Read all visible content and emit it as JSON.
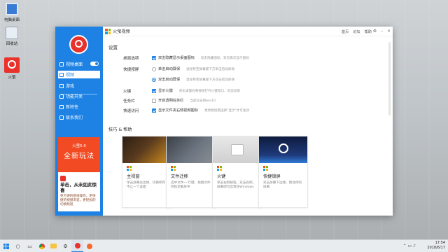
{
  "desktop": {
    "icons": [
      {
        "label": "电脑桌面"
      },
      {
        "label": "回收站"
      },
      {
        "label": "火萤"
      }
    ]
  },
  "window": {
    "title": "火萤视频",
    "links": [
      "首页",
      "论坛",
      "帮助"
    ]
  },
  "sidebar": {
    "items": [
      {
        "label": "视频桌面",
        "active": false
      },
      {
        "label": "视频",
        "active": true
      },
      {
        "label": "游戏",
        "active": false
      },
      {
        "label": "功能开关",
        "active": false
      },
      {
        "label": "新特性",
        "active": false
      },
      {
        "label": "联系我们",
        "active": false
      }
    ],
    "promo": {
      "version": "火萤5.0",
      "headline": "全新玩法",
      "title": "单击，从未如此惊喜",
      "desc": "更方便的壁纸操作，更快捷的视频浏览，更轻松的切换频道"
    }
  },
  "settings": {
    "heading": "设置",
    "rows": [
      {
        "label": "桌面选项",
        "options": [
          {
            "kind": "checkbox",
            "checked": true,
            "text": "双击隐藏显示桌面图标",
            "hint": "双击隐藏图标，双击再次显示图标"
          }
        ]
      },
      {
        "label": "快捷按屏",
        "options": [
          {
            "kind": "radio",
            "checked": false,
            "text": "单击启动屏保",
            "hint": "鼠标移至屏幕最下方单击启动屏保"
          },
          {
            "kind": "radio",
            "checked": true,
            "text": "双击启动屏保",
            "hint": "鼠标移至屏幕最下方双击启动屏保"
          }
        ]
      },
      {
        "label": "火键",
        "options": [
          {
            "kind": "checkbox",
            "checked": true,
            "text": "显示火键",
            "hint": "单击桌面右侧按钮打开火键窗口，双击退屏"
          }
        ]
      },
      {
        "label": "任务栏",
        "options": [
          {
            "kind": "checkbox",
            "checked": false,
            "text": "开启透明任务栏",
            "hint": "当前仅支持win10"
          }
        ]
      },
      {
        "label": "快速访问",
        "options": [
          {
            "kind": "checkbox",
            "checked": true,
            "text": "显示文件夹右侧视频图标",
            "hint": "更改壁纸需选择\"显示\"才可生效"
          }
        ]
      }
    ]
  },
  "tips": {
    "heading": "技巧 & 帮助",
    "cards": [
      {
        "title": "主视窗",
        "desc": "单击屏幕左边缘，切换所有不止一个桌面"
      },
      {
        "title": "文件迁移",
        "desc": "选中文件一 行键，拖拽文件到指定截屏中"
      },
      {
        "title": "火键",
        "desc": "单击右侧按钮，双击右侧，屏幕即可出现在Windows"
      },
      {
        "title": "快捷锁屏",
        "desc": "双击屏幕下边缘，锁住你的屏幕"
      }
    ]
  },
  "taskbar": {
    "time": "17:54",
    "date": "2018/6/17"
  },
  "colors": {
    "accent": "#1e82e4",
    "brand_red": "#e8322b",
    "promo_orange": "#f24b24"
  }
}
